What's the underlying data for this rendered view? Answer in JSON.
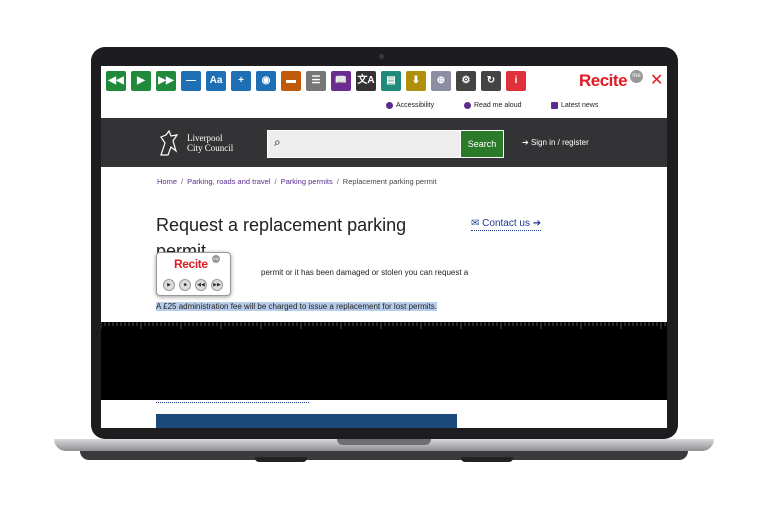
{
  "toolbar": {
    "buttons": [
      {
        "icon": "rewind-icon",
        "glyph": "◀◀",
        "color": "#1f8a3a"
      },
      {
        "icon": "play-icon",
        "glyph": "▶",
        "color": "#1f8a3a"
      },
      {
        "icon": "fast-forward-icon",
        "glyph": "▶▶",
        "color": "#1f8a3a"
      },
      {
        "icon": "decrease-text-icon",
        "glyph": "—",
        "color": "#1f6fb4"
      },
      {
        "icon": "font-icon",
        "glyph": "Aa",
        "color": "#1f6fb4"
      },
      {
        "icon": "increase-text-icon",
        "glyph": "+",
        "color": "#1f6fb4"
      },
      {
        "icon": "color-wheel-icon",
        "glyph": "◉",
        "color": "#1f6fb4"
      },
      {
        "icon": "ruler-icon",
        "glyph": "▬",
        "color": "#c05a0a"
      },
      {
        "icon": "screen-mask-icon",
        "glyph": "☰",
        "color": "#777777"
      },
      {
        "icon": "dictionary-icon",
        "glyph": "📖",
        "color": "#6b2c91"
      },
      {
        "icon": "translate-icon",
        "glyph": "文A",
        "color": "#333333"
      },
      {
        "icon": "text-mode-icon",
        "glyph": "▤",
        "color": "#1f8a7a"
      },
      {
        "icon": "download-icon",
        "glyph": "⬇",
        "color": "#b0900a"
      },
      {
        "icon": "magnifier-icon",
        "glyph": "⊕",
        "color": "#8a8ea0"
      },
      {
        "icon": "settings-icon",
        "glyph": "⚙",
        "color": "#444444"
      },
      {
        "icon": "reset-icon",
        "glyph": "↻",
        "color": "#444444"
      },
      {
        "icon": "info-icon",
        "glyph": "i",
        "color": "#e0303a"
      }
    ],
    "logo": "Recite",
    "logo_badge": "me",
    "close_icon": "close-icon"
  },
  "utility": {
    "accessibility": "Accessibility",
    "read_aloud": "Read me aloud",
    "latest_news": "Latest news"
  },
  "header": {
    "council_line1": "Liverpool",
    "council_line2": "City Council",
    "search_button": "Search",
    "signin": "Sign in / register"
  },
  "breadcrumb": {
    "home": "Home",
    "parking_roads": "Parking, roads and travel",
    "parking_permits": "Parking permits",
    "current": "Replacement parking permit"
  },
  "main": {
    "title": "Request a replacement parking permit",
    "contact_link": "Contact us",
    "body_fragment": "permit or it has been damaged or stolen you can request a",
    "highlighted_sentence": "A £25 administration fee will be charged to issue a replacement for lost permits."
  },
  "player": {
    "logo": "Recite",
    "badge": "me",
    "buttons": [
      "▶",
      "■",
      "◀◀",
      "▶▶"
    ]
  },
  "colors": {
    "recite_red": "#e11b22",
    "header_bg": "#333335",
    "search_green": "#2a7a2a",
    "link_purple": "#5b2c8e",
    "highlight": "#b7cdea"
  }
}
